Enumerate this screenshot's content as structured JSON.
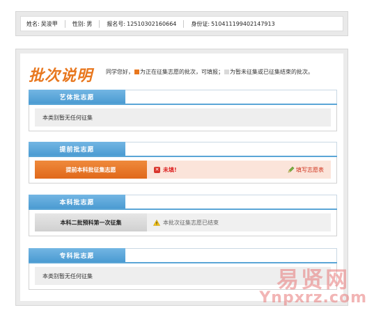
{
  "info": {
    "name_label": "姓名:",
    "name_value": "吴浚甲",
    "gender_label": "性别:",
    "gender_value": "男",
    "exam_no_label": "报名号:",
    "exam_no_value": "12510302160664",
    "id_label": "身份证:",
    "id_value": "510411199402147913"
  },
  "batch_info": {
    "logo_text": "批次说明",
    "legend_prefix": "同学您好，",
    "legend_active": "为正在征集志愿的批次，可填报；",
    "legend_closed": "为暂未征集或已征集结束的批次。",
    "active_color": "#e8771e",
    "closed_color": "#d9d9d9"
  },
  "sections": [
    {
      "title": "艺体批志愿",
      "empty_text": "本类别暂无任何征集"
    },
    {
      "title": "提前批志愿",
      "button": "提前本科批征集志愿",
      "status": "未填!",
      "link": "填写志愿表"
    },
    {
      "title": "本科批志愿",
      "button": "本科二批预科第一次征集",
      "status": "本批次征集志愿已结束"
    },
    {
      "title": "专科批志愿",
      "empty_text": "本类别暂无任何征集"
    }
  ],
  "watermark": {
    "cn": "易贤网",
    "en": "Ynpxrz.com"
  },
  "icons": {
    "not_filled": "x-shield-icon",
    "edit": "pencil-icon",
    "warning": "warning-icon"
  }
}
